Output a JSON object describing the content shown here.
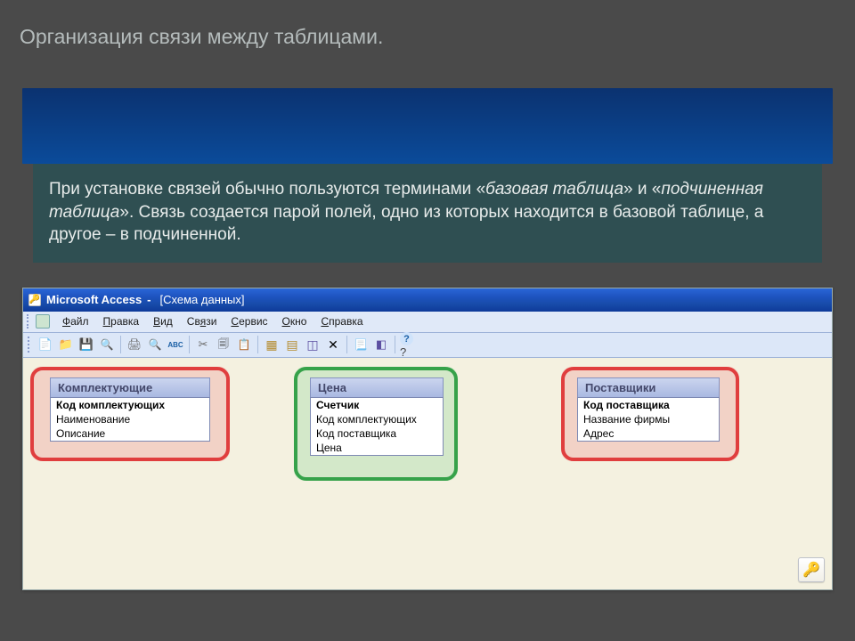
{
  "slide_title": "Организация связи между таблицами.",
  "teal_text": {
    "p1_a": "При установке связей обычно пользуются терминами «",
    "p1_b": "базовая таблица",
    "p1_c": "» и «",
    "p1_d": "подчиненная таблица",
    "p1_e": "». Связь создается парой полей, одно из которых находится в базовой таблице, а другое – в подчиненной."
  },
  "titlebar": {
    "app": "Microsoft Access",
    "sep": " - ",
    "doc": "[Схема данных]"
  },
  "menu": {
    "file": "Файл",
    "edit": "Правка",
    "view": "Вид",
    "rel": "Связи",
    "service": "Сервис",
    "window": "Окно",
    "help": "Справка"
  },
  "tables": {
    "t1": {
      "title": "Комплектующие",
      "rows": [
        "Код комплектующих",
        "Наименование",
        "Описание"
      ]
    },
    "t2": {
      "title": "Цена",
      "rows": [
        "Счетчик",
        "Код комплектующих",
        "Код поставщика",
        "Цена"
      ]
    },
    "t3": {
      "title": "Поставщики",
      "rows": [
        "Код поставщика",
        "Название фирмы",
        "Адрес"
      ]
    }
  }
}
